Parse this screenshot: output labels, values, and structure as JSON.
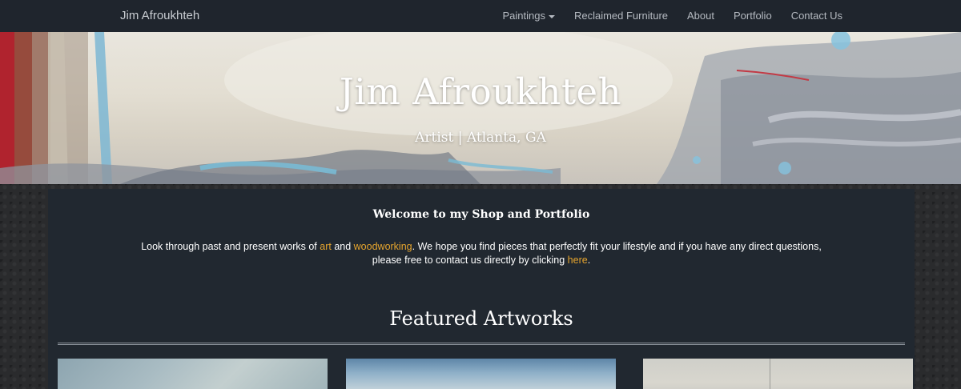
{
  "navbar": {
    "brand": "Jim Afroukhteh",
    "items": [
      {
        "label": "Paintings",
        "dropdown": true
      },
      {
        "label": "Reclaimed Furniture"
      },
      {
        "label": "About"
      },
      {
        "label": "Portfolio"
      },
      {
        "label": "Contact Us"
      }
    ]
  },
  "hero": {
    "title": "Jim Afroukhteh",
    "subtitle": "Artist | Atlanta, GA"
  },
  "main": {
    "welcome": "Welcome to my Shop and Portfolio",
    "intro": {
      "part1": "Look through past and present works of ",
      "link_art": "art",
      "part2": " and ",
      "link_woodworking": "woodworking",
      "part3": ". We hope you find pieces that perfectly fit your lifestyle and if you have any direct questions,",
      "part4": "please free to contact us directly by clicking ",
      "link_here": "here",
      "part5": "."
    },
    "featured_heading": "Featured Artworks"
  },
  "colors": {
    "navbar_bg": "#1f252d",
    "panel_bg": "#212830",
    "link": "#e6a52e"
  }
}
